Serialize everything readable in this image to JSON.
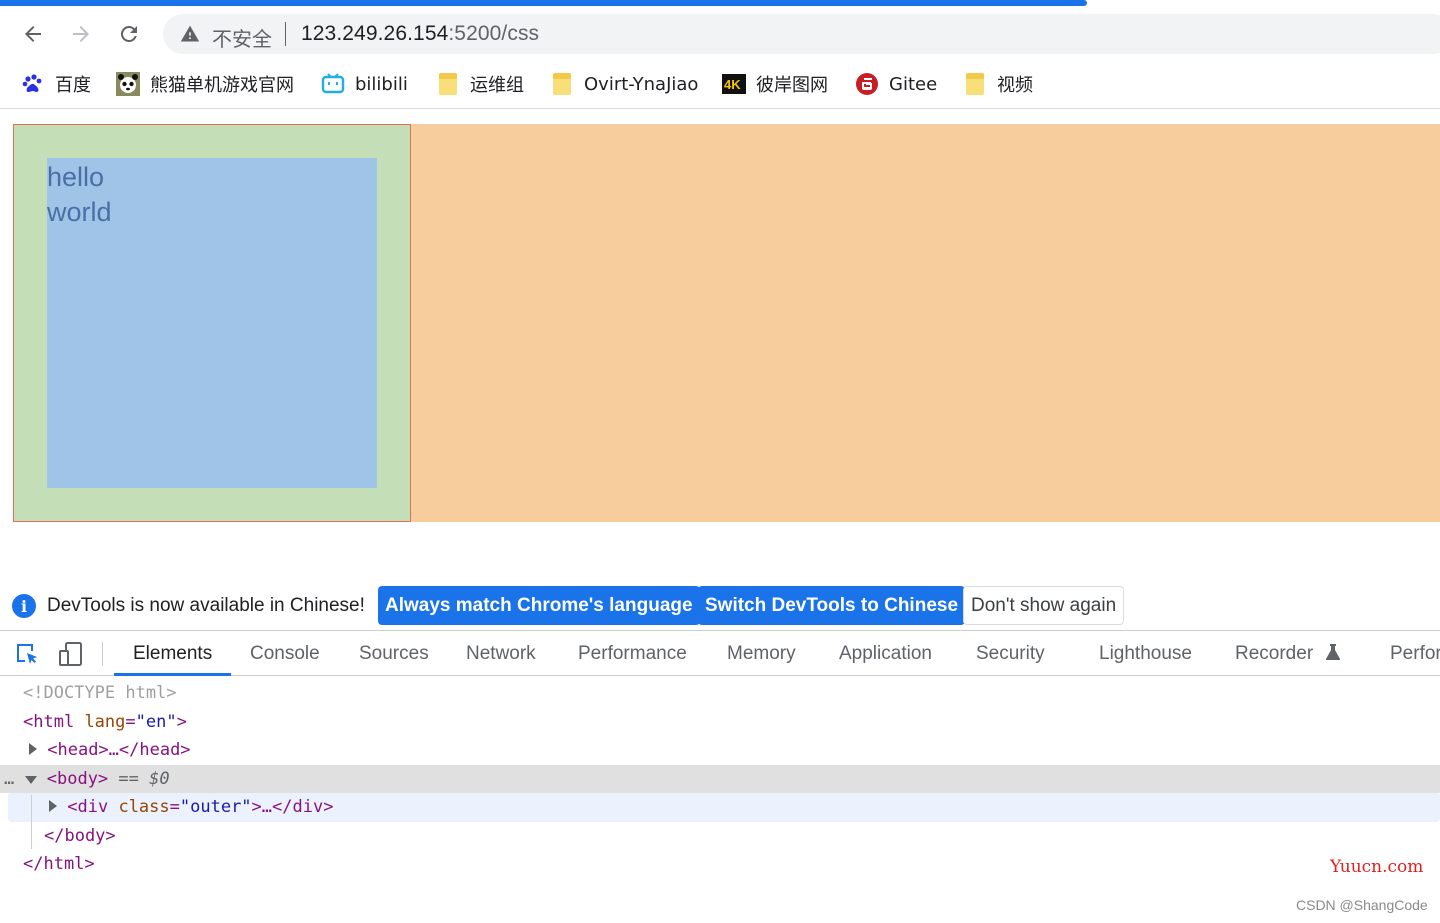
{
  "browser": {
    "omnibox": {
      "security_label": "不安全",
      "url_host": "123.249.26.154",
      "url_path": ":5200/css"
    },
    "bookmarks": [
      {
        "label": "百度",
        "icon": "baidu-paw-icon"
      },
      {
        "label": "熊猫单机游戏官网",
        "icon": "panda-icon"
      },
      {
        "label": "bilibili",
        "icon": "bilibili-tv-icon"
      },
      {
        "label": "运维组",
        "icon": "folder-icon"
      },
      {
        "label": "Ovirt-YnaJiao",
        "icon": "folder-icon"
      },
      {
        "label": "彼岸图网",
        "icon": "4k-icon"
      },
      {
        "label": "Gitee",
        "icon": "gitee-icon"
      },
      {
        "label": "视频",
        "icon": "folder-icon"
      }
    ]
  },
  "page": {
    "inner_text_line1": "hello",
    "inner_text_line2": "world",
    "colors": {
      "outer_bg": "#c4dfb8",
      "inner_bg": "#a0c4e8",
      "margin_bg": "#f7cd9e"
    }
  },
  "infobar": {
    "message": "DevTools is now available in Chinese!",
    "btn_match": "Always match Chrome's language",
    "btn_switch": "Switch DevTools to Chinese",
    "btn_dismiss": "Don't show again"
  },
  "devtools": {
    "tabs": [
      "Elements",
      "Console",
      "Sources",
      "Network",
      "Performance",
      "Memory",
      "Application",
      "Security",
      "Lighthouse",
      "Recorder",
      "Perfor"
    ],
    "active_tab": "Elements",
    "tree": {
      "doctype": "<!DOCTYPE html>",
      "html_open_tag": "<html",
      "html_attr": "lang",
      "html_attr_val": "\"en\"",
      "head_collapsed": "<head>…</head>",
      "body_open": "<body>",
      "body_marker": "== $0",
      "div_open": "<div",
      "div_attr": "class",
      "div_attr_val": "\"outer\"",
      "div_rest": ">…</div>",
      "body_close": "</body>",
      "html_close": "</html>",
      "ellipsis": "…"
    }
  },
  "watermarks": {
    "site": "Yuucn.com",
    "author": "CSDN @ShangCode"
  }
}
